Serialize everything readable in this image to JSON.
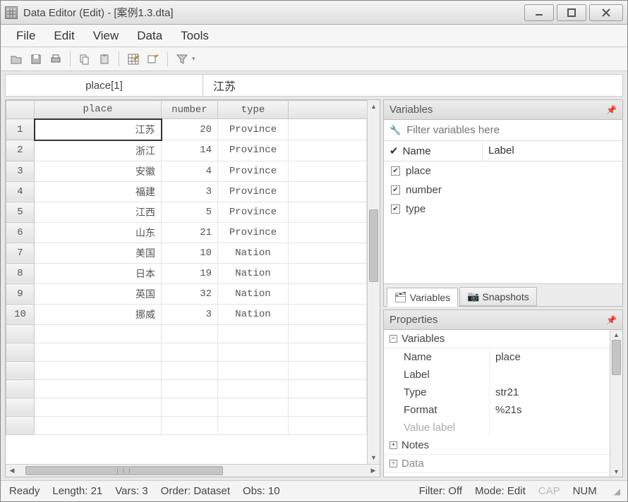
{
  "window": {
    "title": "Data Editor (Edit) - [案例1.3.dta]"
  },
  "menu": [
    "File",
    "Edit",
    "View",
    "Data",
    "Tools"
  ],
  "toolbar_icons": [
    "open",
    "save",
    "print",
    "copy",
    "paste",
    "grid-edit",
    "label",
    "filter"
  ],
  "edit": {
    "cell_ref": "place[1]",
    "cell_value": "江苏"
  },
  "columns": [
    "place",
    "number",
    "type"
  ],
  "rows": [
    {
      "n": 1,
      "place": "江苏",
      "number": 20,
      "type": "Province"
    },
    {
      "n": 2,
      "place": "浙江",
      "number": 14,
      "type": "Province"
    },
    {
      "n": 3,
      "place": "安徽",
      "number": 4,
      "type": "Province"
    },
    {
      "n": 4,
      "place": "福建",
      "number": 3,
      "type": "Province"
    },
    {
      "n": 5,
      "place": "江西",
      "number": 5,
      "type": "Province"
    },
    {
      "n": 6,
      "place": "山东",
      "number": 21,
      "type": "Province"
    },
    {
      "n": 7,
      "place": "美国",
      "number": 10,
      "type": "Nation"
    },
    {
      "n": 8,
      "place": "日本",
      "number": 19,
      "type": "Nation"
    },
    {
      "n": 9,
      "place": "英国",
      "number": 32,
      "type": "Nation"
    },
    {
      "n": 10,
      "place": "挪威",
      "number": 3,
      "type": "Nation"
    }
  ],
  "variables_panel": {
    "title": "Variables",
    "filter_placeholder": "Filter variables here",
    "col_headers": [
      "Name",
      "Label"
    ],
    "items": [
      "place",
      "number",
      "type"
    ],
    "tabs": [
      "Variables",
      "Snapshots"
    ]
  },
  "properties_panel": {
    "title": "Properties",
    "group1": "Variables",
    "rows": [
      {
        "k": "Name",
        "v": "place"
      },
      {
        "k": "Label",
        "v": ""
      },
      {
        "k": "Type",
        "v": "str21"
      },
      {
        "k": "Format",
        "v": "%21s"
      },
      {
        "k": "Value label",
        "v": "",
        "dim": true
      }
    ],
    "group2": "Notes",
    "group3": "Data"
  },
  "status": {
    "ready": "Ready",
    "length": "Length: 21",
    "vars": "Vars: 3",
    "order": "Order: Dataset",
    "obs": "Obs: 10",
    "filter": "Filter: Off",
    "mode": "Mode: Edit",
    "cap": "CAP",
    "num": "NUM"
  }
}
